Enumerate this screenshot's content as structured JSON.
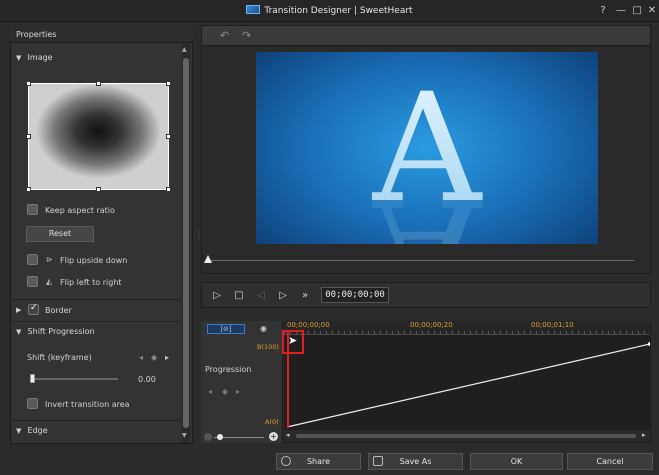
{
  "window": {
    "title": "Transition Designer | SweetHeart",
    "help_label": "?",
    "minimize_label": "—",
    "maximize_label": "□",
    "close_label": "✕"
  },
  "properties": {
    "header": "Properties",
    "image_section": "Image",
    "keep_aspect": "Keep aspect ratio",
    "reset": "Reset",
    "flip_upside_down": "Flip upside down",
    "flip_left_to_right": "Flip left to right",
    "border_section": "Border",
    "shift_section": "Shift Progression",
    "shift_label": "Shift (keyframe)",
    "shift_value": "0.00",
    "shift_level": 0,
    "invert_transition": "Invert transition area",
    "edge_section": "Edge"
  },
  "preview": {
    "letter": "A",
    "accent": "#2b9be0",
    "slider_level": 0
  },
  "playback": {
    "timecode": "00;00;00;00"
  },
  "timeline": {
    "tick_labels": [
      "00;00;00;00",
      "00;00;00;20",
      "00;00;01;10"
    ],
    "track_label": "Progression",
    "y_top_label": "B(100)",
    "y_bottom_label": "A(0)",
    "playhead_color": "#e02020",
    "curve_start_value": 0,
    "curve_end_value": 100
  },
  "footer": {
    "share": "Share",
    "save_as": "Save As",
    "ok": "OK",
    "cancel": "Cancel"
  }
}
